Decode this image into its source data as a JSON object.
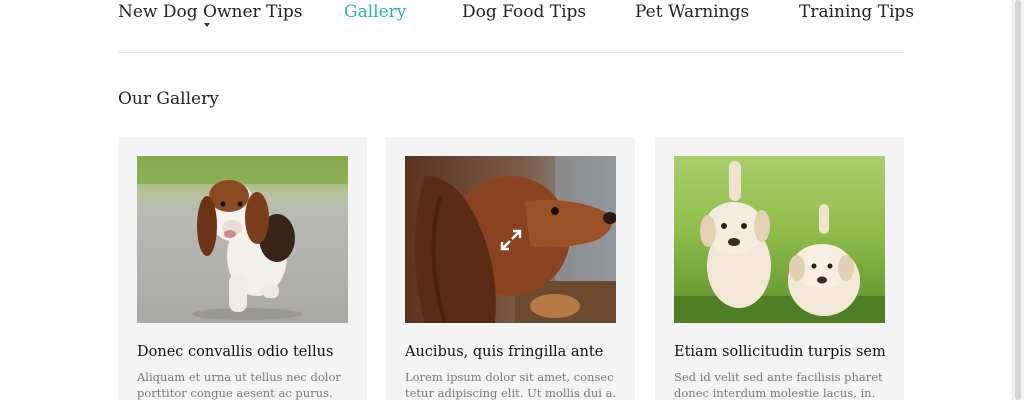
{
  "nav": {
    "items": [
      {
        "label": "New Dog Owner Tips"
      },
      {
        "label": "Gallery"
      },
      {
        "label": "Dog Food Tips"
      },
      {
        "label": "Pet Warnings"
      },
      {
        "label": "Training Tips"
      }
    ],
    "active_index": 1
  },
  "gallery": {
    "title": "Our Gallery",
    "cards": [
      {
        "image": "basset-hound-running-photo",
        "title": "Donec convallis odio tellus",
        "text_lines": [
          "Aliquam et urna ut tellus nec dolor",
          "porttitor congue aesent ac purus."
        ]
      },
      {
        "image": "setter-dog-profile-photo",
        "title": "Aucibus, quis fringilla ante",
        "text_lines": [
          "Lorem ipsum dolor sit amet, consec",
          "tetur adipiscing elit. Ut mollis dui a."
        ]
      },
      {
        "image": "labrador-puppies-on-grass-photo",
        "title": "Etiam sollicitudin turpis sem",
        "text_lines": [
          "Sed id velit sed ante facilisis pharet",
          "donec interdum molestie lacus, in."
        ]
      }
    ]
  },
  "colors": {
    "accent": "#2bb3a6",
    "text": "#222222",
    "muted": "#777777",
    "card_bg": "#f4f4f4"
  },
  "icons": {
    "expand": "expand-arrows-icon",
    "dropdown": "caret-down-icon"
  }
}
